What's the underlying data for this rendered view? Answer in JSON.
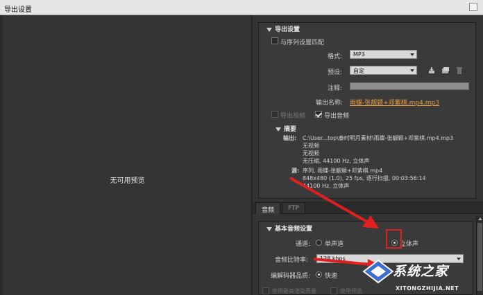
{
  "window": {
    "title": "导出设置"
  },
  "preview": {
    "message": "无可用预览"
  },
  "export_settings": {
    "header": "导出设置",
    "match_sequence_label": "与序列设置匹配",
    "format_label": "格式:",
    "format_value": "MP3",
    "preset_label": "预设:",
    "preset_value": "自定",
    "comment_label": "注释:",
    "output_name_label": "输出名称:",
    "output_name_value": "雨蝶-张靓颖+邓紫棋.mp4.mp3",
    "export_video_label": "导出视频",
    "export_audio_label": "导出音频"
  },
  "summary": {
    "header": "摘要",
    "output_label": "输出:",
    "output_lines": [
      "C:\\User...top\\泰时明月素材\\雨蝶-张靓颖+邓紫棋.mp4.mp3",
      "无视频",
      "无视频",
      "无压缩, 44100 Hz, 立体声"
    ],
    "source_label": "源:",
    "source_lines": [
      "序列, 雨蝶-张靓颖+邓紫棋.mp4",
      "848x480 (1.0), 25 fps, 逐行扫描, 00:03:56:14",
      "44100 Hz, 立体声"
    ]
  },
  "tabs": [
    {
      "label": "音频"
    },
    {
      "label": "FTP"
    }
  ],
  "audio": {
    "header": "基本音频设置",
    "channel_label": "通道:",
    "mono_label": "单声道",
    "stereo_label": "立体声",
    "bitrate_label": "音频比特率:",
    "bitrate_value": "128 kbps",
    "quality_label": "编解码器品质:",
    "quality_value": "快速"
  },
  "bottom": {
    "max_render_label": "使用最高渲染质量",
    "use_preview_label": "使用预览"
  },
  "watermark": {
    "text": "系统之家",
    "url": "XITONGZHIJIA.NET"
  },
  "colors": {
    "accent_link": "#f0a040",
    "annotation_red": "#e02020"
  }
}
